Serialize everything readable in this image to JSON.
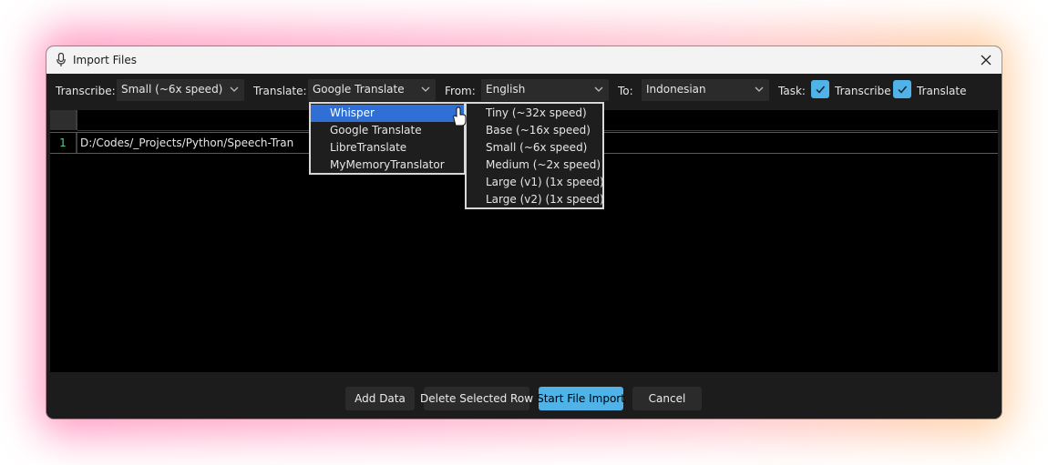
{
  "window": {
    "title": "Import Files"
  },
  "toolbar": {
    "transcribe_label": "Transcribe:",
    "transcribe_value": "Small (~6x speed)",
    "translate_label": "Translate:",
    "translate_value": "Google Translate",
    "from_label": "From:",
    "from_value": "English",
    "to_label": "To:",
    "to_value": "Indonesian",
    "task_label": "Task:",
    "task_transcribe": "Transcribe",
    "task_translate": "Translate",
    "task_transcribe_checked": true,
    "task_translate_checked": true
  },
  "table": {
    "rows": [
      {
        "num": "1",
        "path": "D:/Codes/_Projects/Python/Speech-Tran"
      }
    ]
  },
  "translate_menu": {
    "items": [
      "Whisper",
      "Google Translate",
      "LibreTranslate",
      "MyMemoryTranslator"
    ],
    "selected_index": 0
  },
  "whisper_submenu": {
    "items": [
      "Tiny (~32x speed)",
      "Base (~16x speed)",
      "Small (~6x speed)",
      "Medium (~2x speed)",
      "Large (v1) (1x speed)",
      "Large (v2) (1x speed)"
    ]
  },
  "footer": {
    "add_data": "Add Data",
    "delete_row": "Delete Selected Row",
    "start_import": "Start File Import",
    "cancel": "Cancel"
  },
  "colors": {
    "accent": "#4fb3e8",
    "menu_highlight": "#2f6fd6",
    "row_number": "#4fd18b"
  },
  "icons": {
    "title": "microphone-icon",
    "close": "close-icon",
    "dropdown": "chevron-down-icon",
    "check": "checkmark-icon",
    "pointer": "hand-cursor-icon"
  }
}
